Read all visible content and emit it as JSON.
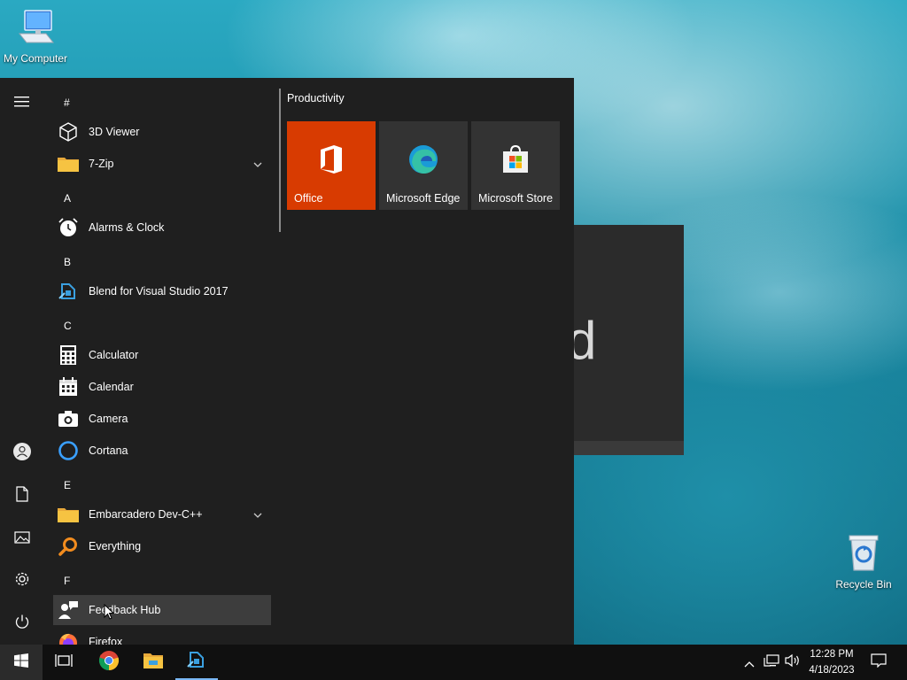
{
  "desktop": {
    "icons": [
      {
        "label": "My Computer",
        "icon": "monitor-icon"
      },
      {
        "label": "Recycle Bin",
        "icon": "recycle-bin-icon"
      }
    ]
  },
  "ghost_window": {
    "glyph": "d"
  },
  "start_menu": {
    "rail": {
      "menu": "hamburger-icon",
      "account": "user-icon",
      "documents": "document-icon",
      "pictures": "pictures-icon",
      "settings": "gear-icon",
      "power": "power-icon"
    },
    "apps": [
      {
        "type": "header",
        "label": "#"
      },
      {
        "type": "app",
        "label": "3D Viewer",
        "icon": "3d-viewer-icon"
      },
      {
        "type": "app",
        "label": "7-Zip",
        "icon": "folder-icon",
        "expandable": true
      },
      {
        "type": "header",
        "label": "A"
      },
      {
        "type": "app",
        "label": "Alarms & Clock",
        "icon": "alarm-clock-icon"
      },
      {
        "type": "header",
        "label": "B"
      },
      {
        "type": "app",
        "label": "Blend for Visual Studio 2017",
        "icon": "blend-icon"
      },
      {
        "type": "header",
        "label": "C"
      },
      {
        "type": "app",
        "label": "Calculator",
        "icon": "calculator-icon"
      },
      {
        "type": "app",
        "label": "Calendar",
        "icon": "calendar-icon"
      },
      {
        "type": "app",
        "label": "Camera",
        "icon": "camera-icon"
      },
      {
        "type": "app",
        "label": "Cortana",
        "icon": "cortana-icon"
      },
      {
        "type": "header",
        "label": "E"
      },
      {
        "type": "app",
        "label": "Embarcadero Dev-C++",
        "icon": "folder-icon",
        "expandable": true
      },
      {
        "type": "app",
        "label": "Everything",
        "icon": "magnifier-icon"
      },
      {
        "type": "header",
        "label": "F"
      },
      {
        "type": "app",
        "label": "Feedback Hub",
        "icon": "feedback-icon",
        "highlighted": true
      },
      {
        "type": "app",
        "label": "Firefox",
        "icon": "firefox-icon"
      }
    ],
    "tiles": {
      "group_title": "Productivity",
      "items": [
        {
          "label": "Office",
          "color": "#d83b01",
          "icon": "office-icon"
        },
        {
          "label": "Microsoft Edge",
          "color": "#333333",
          "icon": "edge-icon"
        },
        {
          "label": "Microsoft Store",
          "color": "#333333",
          "icon": "store-icon"
        }
      ]
    }
  },
  "taskbar": {
    "start": "windows-logo-icon",
    "task_view": "task-view-icon",
    "pinned": [
      "chrome-icon",
      "file-explorer-icon",
      "blend-icon"
    ],
    "tray": {
      "chevron": "chevron-up-icon",
      "network": "network-icon",
      "volume": "volume-icon",
      "time": "12:28 PM",
      "date": "4/18/2023",
      "notifications": "notification-icon"
    }
  }
}
